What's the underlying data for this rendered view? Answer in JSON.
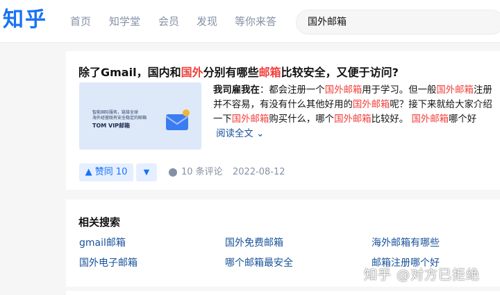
{
  "header": {
    "logo": "知乎",
    "nav": [
      "首页",
      "知学堂",
      "会员",
      "发现",
      "等你来答"
    ],
    "search_value": "国外邮箱"
  },
  "answer": {
    "title_parts": [
      "除了Gmail，国内和",
      "国外",
      "分别有哪些",
      "邮箱",
      "比较安全，又便于访问?"
    ],
    "thumb_lines": [
      "智能国际服务，链接全球",
      "海外经营既有安全稳定的邮箱"
    ],
    "thumb_brand": "TOM VIP邮箱",
    "author": "我司雇我在",
    "excerpt_parts": [
      "：都会注册一个",
      "国外邮箱",
      "用于学习。但一般",
      "国外邮箱",
      "注册并不容易，有没有什么其他好用的",
      "国外邮箱",
      "呢？接下来就给大家介绍一下",
      "国外邮箱",
      "购买什么，哪个",
      "国外邮箱",
      "比较好。 ",
      "国外邮箱",
      "哪个好"
    ],
    "read_more": "阅读全文",
    "upvote_label": "赞同 10",
    "comments": "10 条评论",
    "date": "2022-08-12"
  },
  "related": {
    "title": "相关搜索",
    "links": [
      "gmail邮箱",
      "国外免费邮箱",
      "海外邮箱有哪些",
      "国外电子邮箱",
      "哪个邮箱最安全",
      "邮箱注册哪个好"
    ]
  },
  "watermark": "知乎 @对方已拒绝",
  "colors": {
    "brand": "#1772f6",
    "highlight": "#f1403c",
    "link": "#175199",
    "muted": "#8590a6"
  }
}
